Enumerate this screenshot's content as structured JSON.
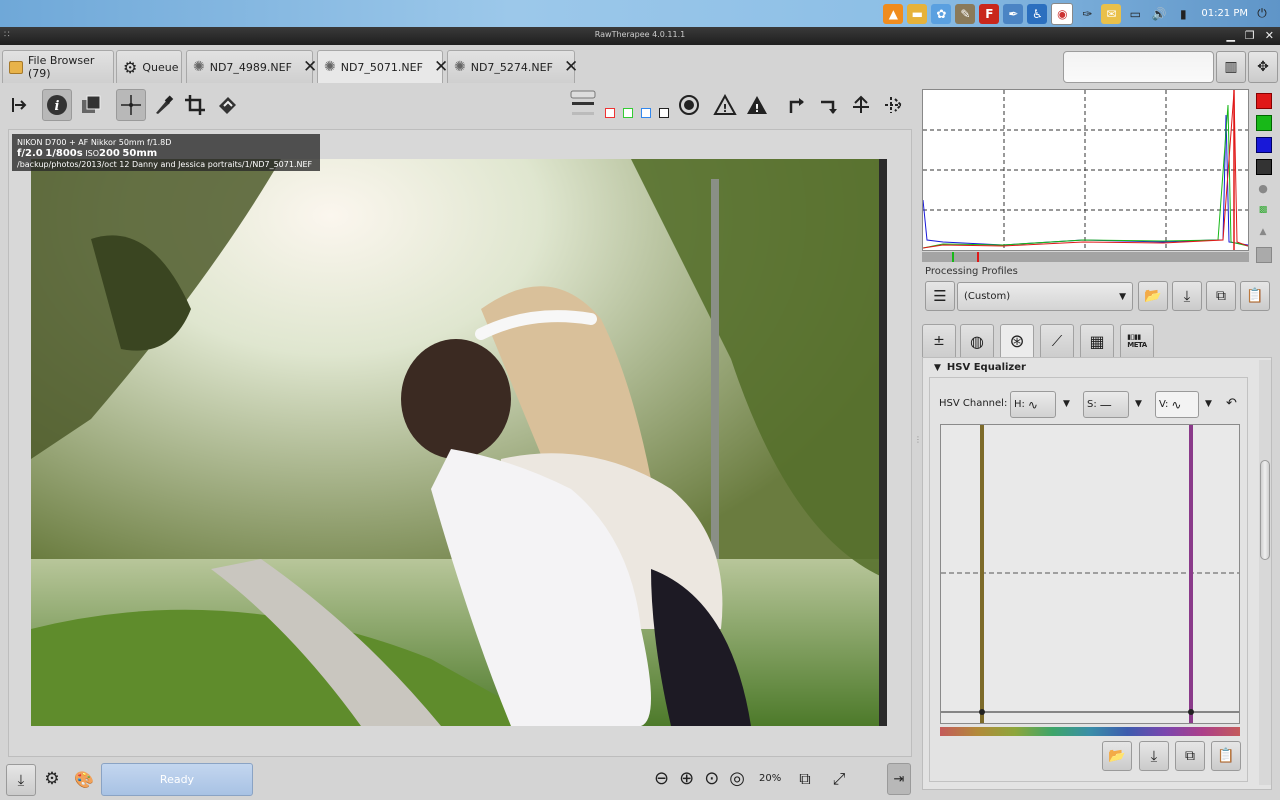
{
  "desktop": {
    "clock": "01:21 PM",
    "tray_icons": [
      "vlc-icon",
      "folder-icon",
      "picasa-icon",
      "gimp-icon",
      "filezilla-icon",
      "bluefish-icon",
      "accessibility-icon",
      "chrome-icon",
      "inkscape-icon",
      "notes-icon",
      "network-icon",
      "volume-icon",
      "battery-icon",
      "power-icon"
    ]
  },
  "window": {
    "title": "RawTherapee 4.0.11.1"
  },
  "tabs": [
    {
      "label": "File Browser (79)",
      "icon": "folder-icon"
    },
    {
      "label": "Queue",
      "icon": "gears-icon"
    },
    {
      "label": "ND7_4989.NEF",
      "icon": "raw-file-icon",
      "closable": true
    },
    {
      "label": "ND7_5071.NEF",
      "icon": "raw-file-icon",
      "closable": true,
      "active": true
    },
    {
      "label": "ND7_5274.NEF",
      "icon": "raw-file-icon",
      "closable": true
    }
  ],
  "image_info": {
    "line1": "NIKON D700 + AF Nikkor 50mm f/1.8D",
    "aperture": "f/2.0",
    "shutter": "1/800s",
    "iso_label": "ISO",
    "iso": "200",
    "focal": "50mm",
    "path": "/backup/photos/2013/oct 12 Danny and Jessica portraits/1/ND7_5071.NEF"
  },
  "status": {
    "ready_label": "Ready",
    "zoom_level": "20%"
  },
  "processing_profiles": {
    "label": "Processing Profiles",
    "selected": "(Custom)"
  },
  "hsv_equalizer": {
    "title": "HSV Equalizer",
    "channel_label": "HSV Channel:",
    "h_label": "H:",
    "s_label": "S:",
    "v_label": "V:"
  },
  "colors": {
    "accent": "#a8c2e4",
    "histo_red": "#e01818",
    "histo_green": "#18b818",
    "histo_blue": "#1818d8",
    "curve_left_line": "#7d6b2a",
    "curve_right_line": "#8a3a8a"
  }
}
